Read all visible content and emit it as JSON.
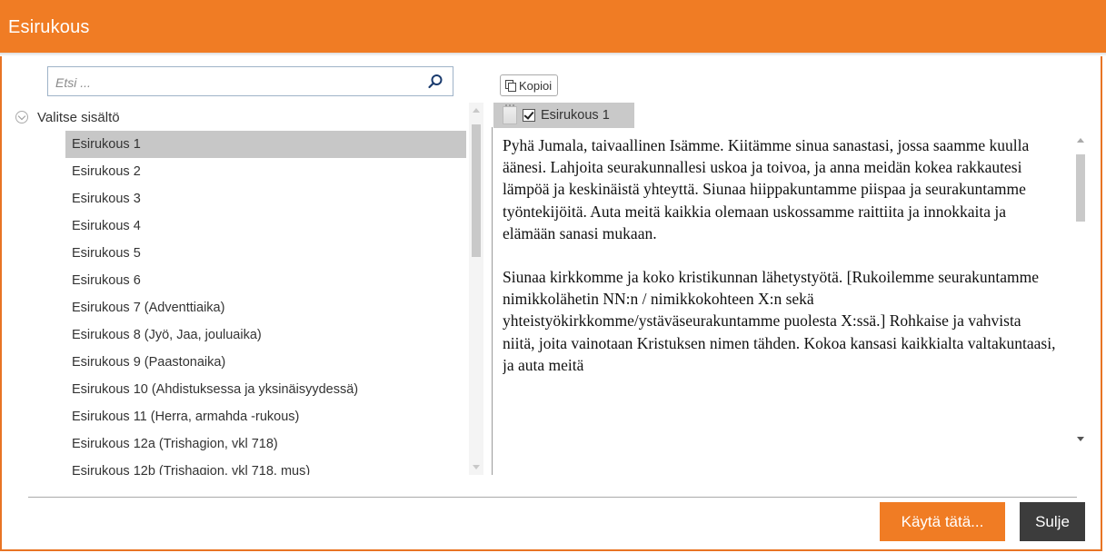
{
  "dialog": {
    "title": "Esirukous"
  },
  "search": {
    "placeholder": "Etsi ..."
  },
  "tree": {
    "root_label": "Valitse sisältö",
    "items": [
      "Esirukous 1",
      "Esirukous 2",
      "Esirukous 3",
      "Esirukous 4",
      "Esirukous 5",
      "Esirukous 6",
      "Esirukous 7 (Adventtiaika)",
      "Esirukous 8 (Jyö, Jaa, jouluaika)",
      "Esirukous 9 (Paastonaika)",
      "Esirukous 10 (Ahdistuksessa ja yksinäisyydessä)",
      "Esirukous 11 (Herra, armahda -rukous)",
      "Esirukous 12a (Trishagion, vkl 718)",
      "Esirukous 12b (Trishagion, vkl 718, mus)"
    ],
    "selected_index": 0
  },
  "toolbar": {
    "copy_label": "Kopioi"
  },
  "preview": {
    "selected_label": "Esirukous 1",
    "checked": true,
    "paragraphs": [
      "Pyhä Jumala, taivaallinen Isämme. Kiitämme sinua sanastasi, jossa saamme kuulla äänesi. Lahjoita seurakunnallesi uskoa ja toivoa, ja anna meidän kokea rakkautesi lämpöä ja keskinäistä yhteyttä. Siunaa hiippakuntamme piispaa ja seurakuntamme työntekijöitä. Auta meitä kaikkia olemaan uskossamme raittiita ja innokkaita ja elämään sanasi mukaan.",
      "Siunaa kirkkomme ja koko kristikunnan lähetystyötä. [Rukoilemme seurakuntamme nimikkolähetin NN:n / nimikkokohteen X:n sekä yhteistyökirkkomme/ystäväseurakuntamme puolesta X:ssä.] Rohkaise ja vahvista niitä, joita vainotaan Kristuksen nimen tähden. Kokoa kansasi kaikkialta valtakuntaasi, ja auta meitä"
    ]
  },
  "footer": {
    "use_label": "Käytä tätä...",
    "close_label": "Sulje"
  },
  "colors": {
    "accent": "#f07c24",
    "close_button": "#3c3c3c",
    "selection": "#c7c7c7"
  }
}
